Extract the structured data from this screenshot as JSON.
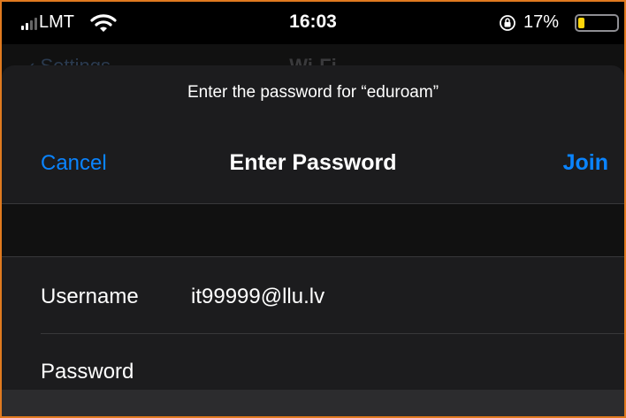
{
  "status_bar": {
    "carrier": "LMT",
    "time": "16:03",
    "battery_percent": "17%",
    "battery_level": 0.17,
    "icons": [
      "signal-icon",
      "wifi-icon",
      "orientation-lock-icon",
      "battery-icon"
    ]
  },
  "background_nav": {
    "back_label": "Settings",
    "title": "Wi-Fi"
  },
  "sheet": {
    "prompt": "Enter the password for “eduroam”",
    "cancel_label": "Cancel",
    "title": "Enter Password",
    "join_label": "Join"
  },
  "form": {
    "username_label": "Username",
    "username_value": "it99999@llu.lv",
    "password_label": "Password",
    "password_value": ""
  },
  "colors": {
    "accent": "#0a84ff",
    "sheet_background": "#1c1c1e",
    "battery_fill": "#ffd60a",
    "frame_border": "#e07a1f"
  }
}
